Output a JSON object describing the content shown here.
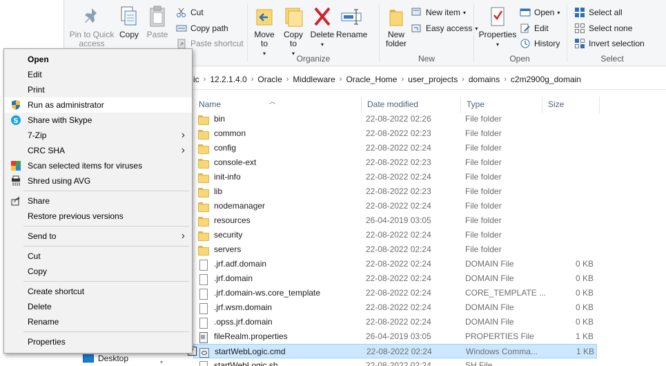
{
  "ribbon": {
    "clipboard": {
      "pin_label": "Pin to Quick access",
      "copy_label": "Copy",
      "paste_label": "Paste",
      "cut_label": "Cut",
      "copy_path_label": "Copy path",
      "paste_shortcut_label": "Paste shortcut"
    },
    "organize": {
      "group_label": "Organize",
      "move_to_label": "Move to",
      "copy_to_label": "Copy to",
      "delete_label": "Delete",
      "rename_label": "Rename"
    },
    "new": {
      "group_label": "New",
      "new_folder_label": "New folder",
      "new_item_label": "New item",
      "easy_access_label": "Easy access"
    },
    "open": {
      "group_label": "Open",
      "properties_label": "Properties",
      "open_label": "Open",
      "edit_label": "Edit",
      "history_label": "History"
    },
    "select": {
      "group_label": "Select",
      "select_all_label": "Select all",
      "select_none_label": "Select none",
      "invert_label": "Invert selection"
    }
  },
  "address": {
    "crumbs": [
      "ic",
      "12.2.1.4.0",
      "Oracle",
      "Middleware",
      "Oracle_Home",
      "user_projects",
      "domains",
      "c2m2900g_domain"
    ],
    "separator": "›"
  },
  "columns": {
    "name": "Name",
    "date": "Date modified",
    "type": "Type",
    "size": "Size"
  },
  "files": [
    {
      "name": "bin",
      "date": "22-08-2022 02:26",
      "type": "File folder",
      "size": "",
      "icon": "folder-icon"
    },
    {
      "name": "common",
      "date": "22-08-2022 02:23",
      "type": "File folder",
      "size": "",
      "icon": "folder-icon"
    },
    {
      "name": "config",
      "date": "22-08-2022 02:24",
      "type": "File folder",
      "size": "",
      "icon": "folder-icon"
    },
    {
      "name": "console-ext",
      "date": "22-08-2022 02:23",
      "type": "File folder",
      "size": "",
      "icon": "folder-icon"
    },
    {
      "name": "init-info",
      "date": "22-08-2022 02:24",
      "type": "File folder",
      "size": "",
      "icon": "folder-icon"
    },
    {
      "name": "lib",
      "date": "22-08-2022 02:23",
      "type": "File folder",
      "size": "",
      "icon": "folder-icon"
    },
    {
      "name": "nodemanager",
      "date": "22-08-2022 02:24",
      "type": "File folder",
      "size": "",
      "icon": "folder-icon"
    },
    {
      "name": "resources",
      "date": "26-04-2019 03:05",
      "type": "File folder",
      "size": "",
      "icon": "folder-icon"
    },
    {
      "name": "security",
      "date": "22-08-2022 02:24",
      "type": "File folder",
      "size": "",
      "icon": "folder-icon"
    },
    {
      "name": "servers",
      "date": "22-08-2022 02:24",
      "type": "File folder",
      "size": "",
      "icon": "folder-icon"
    },
    {
      "name": ".jrf.adf.domain",
      "date": "22-08-2022 02:24",
      "type": "DOMAIN File",
      "size": "0 KB",
      "icon": "file-icon"
    },
    {
      "name": ".jrf.domain",
      "date": "22-08-2022 02:24",
      "type": "DOMAIN File",
      "size": "0 KB",
      "icon": "file-icon"
    },
    {
      "name": ".jrf.domain-ws.core_template",
      "date": "22-08-2022 02:24",
      "type": "CORE_TEMPLATE ...",
      "size": "0 KB",
      "icon": "file-icon"
    },
    {
      "name": ".jrf.wsm.domain",
      "date": "22-08-2022 02:24",
      "type": "DOMAIN File",
      "size": "0 KB",
      "icon": "file-icon"
    },
    {
      "name": ".opss.jrf.domain",
      "date": "22-08-2022 02:24",
      "type": "DOMAIN File",
      "size": "0 KB",
      "icon": "file-icon"
    },
    {
      "name": "fileRealm.properties",
      "date": "26-04-2019 03:05",
      "type": "PROPERTIES File",
      "size": "1 KB",
      "icon": "properties-file-icon"
    },
    {
      "name": "startWebLogic.cmd",
      "date": "22-08-2022 02:24",
      "type": "Windows Comma...",
      "size": "1 KB",
      "icon": "cmd-file-icon",
      "selected": true
    },
    {
      "name": "startWebLogic.sh",
      "date": "22-08-2022 02:24",
      "type": "SH File",
      "size": "",
      "icon": "file-icon"
    }
  ],
  "nav": {
    "desktop_label": "Desktop"
  },
  "context_menu": {
    "items": [
      {
        "label": "Open",
        "bold": true
      },
      {
        "label": "Edit"
      },
      {
        "label": "Print"
      },
      {
        "label": "Run as administrator",
        "icon": "uac-shield-icon",
        "hover": true
      },
      {
        "label": "Share with Skype",
        "icon": "skype-icon"
      },
      {
        "label": "7-Zip",
        "submenu": true
      },
      {
        "label": "CRC SHA",
        "submenu": true
      },
      {
        "label": "Scan selected items for viruses",
        "icon": "avg-icon"
      },
      {
        "label": "Shred using AVG",
        "icon": "shredder-icon"
      },
      {
        "separator": true
      },
      {
        "label": "Share",
        "icon": "share-icon"
      },
      {
        "label": "Restore previous versions"
      },
      {
        "separator": true
      },
      {
        "label": "Send to",
        "submenu": true
      },
      {
        "separator": true
      },
      {
        "label": "Cut"
      },
      {
        "label": "Copy"
      },
      {
        "separator": true
      },
      {
        "label": "Create shortcut"
      },
      {
        "label": "Delete"
      },
      {
        "label": "Rename"
      },
      {
        "separator": true
      },
      {
        "label": "Properties"
      }
    ]
  },
  "colors": {
    "selection_bg": "#cce8ff",
    "selection_border": "#99d1ff",
    "ribbon_bg": "#f5f6f7",
    "menu_bg": "#f2f2f2",
    "header_text": "#4c607a"
  }
}
